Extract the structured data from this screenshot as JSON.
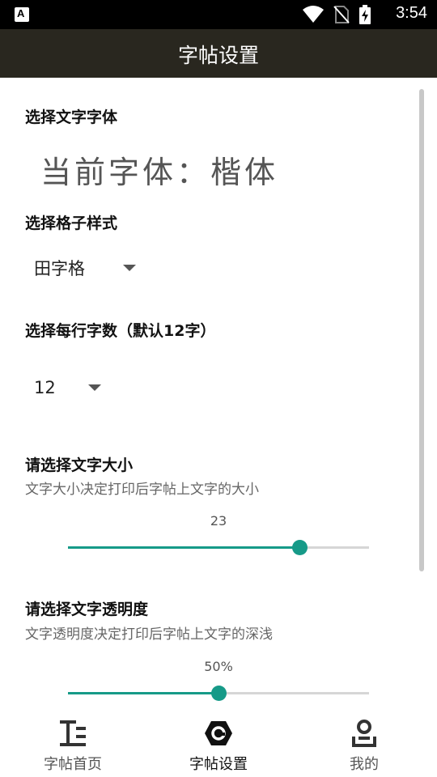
{
  "status_bar": {
    "app_badge": "A",
    "time": "3:54",
    "icons": [
      "wifi-icon",
      "no-sim-icon",
      "battery-charging-icon"
    ]
  },
  "app_bar": {
    "title": "字帖设置"
  },
  "settings": {
    "font_section": {
      "heading": "选择文字字体",
      "preview": "当前字体：楷体"
    },
    "grid_section": {
      "heading": "选择格子样式",
      "selected": "田字格"
    },
    "chars_section": {
      "heading": "选择每行字数（默认12字）",
      "selected": "12"
    },
    "size_section": {
      "heading": "请选择文字大小",
      "description": "文字大小决定打印后字帖上文字的大小",
      "value_label": "23",
      "value_fraction": 0.77
    },
    "opacity_section": {
      "heading": "请选择文字透明度",
      "description": "文字透明度决定打印后字帖上文字的深浅",
      "value_label": "50%",
      "value_fraction": 0.5
    }
  },
  "bottom_nav": {
    "items": [
      {
        "label": "字帖首页",
        "icon": "text-format-icon",
        "active": false
      },
      {
        "label": "字帖设置",
        "icon": "settings-hex-icon",
        "active": true
      },
      {
        "label": "我的",
        "icon": "user-icon",
        "active": false
      }
    ]
  },
  "colors": {
    "accent": "#169a88",
    "app_bar": "#29271f",
    "status_bar": "#000000"
  }
}
